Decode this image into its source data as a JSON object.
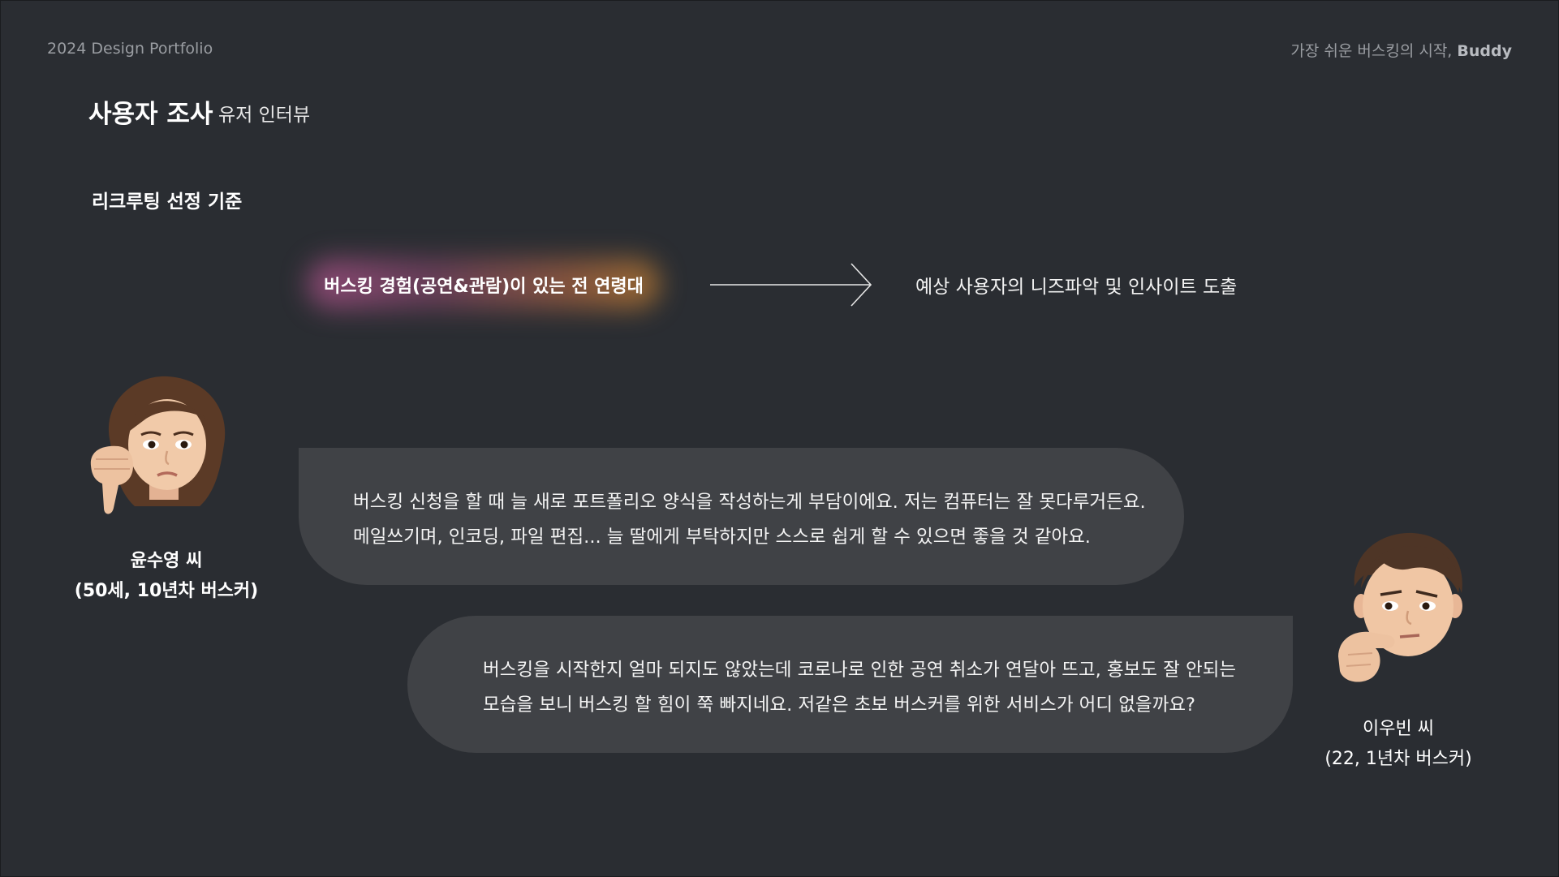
{
  "header": {
    "portfolio_label": "2024 Design Portfolio",
    "tagline_prefix": "가장 쉬운 버스킹의 시작, ",
    "tagline_brand": "Buddy"
  },
  "page": {
    "title": "사용자 조사",
    "subtitle": "유저 인터뷰"
  },
  "recruiting": {
    "section_title": "리크루팅 선정 기준",
    "criteria": "버스킹 경험(공연&관람)이 있는 전 연령대",
    "result": "예상 사용자의 니즈파악 및 인사이트 도출"
  },
  "interviews": [
    {
      "name": "윤수영  씨",
      "detail": "(50세, 10년차 버스커)",
      "quote_lines": [
        "버스킹 신청을 할 때 늘  새로 포트폴리오 양식을 작성하는게 부담이에요. 저는 컴퓨터는 잘 못다루거든요.",
        "메일쓰기며, 인코딩, 파일 편집... 늘 딸에게 부탁하지만 스스로 쉽게 할 수 있으면 좋을 것 같아요."
      ]
    },
    {
      "name": "이우빈  씨",
      "detail": "(22, 1년차 버스커)",
      "quote_lines": [
        "버스킹을 시작한지 얼마 되지도 않았는데 코로나로 인한 공연 취소가 연달아 뜨고, 홍보도 잘 안되는",
        "모습을 보니 버스킹 할 힘이 쭉 빠지네요. 저같은 초보 버스커를 위한 서비스가 어디 없을까요?"
      ]
    }
  ],
  "colors": {
    "background": "#2a2d32",
    "bubble": "#404246",
    "muted_text": "#9a9da2",
    "glow_pink": "#cd5ca0",
    "glow_orange": "#eb9632"
  },
  "icons": {
    "arrow": "arrow-right-icon",
    "avatar_1": "thumbs-down-memoji-icon",
    "avatar_2": "thinking-memoji-icon"
  }
}
